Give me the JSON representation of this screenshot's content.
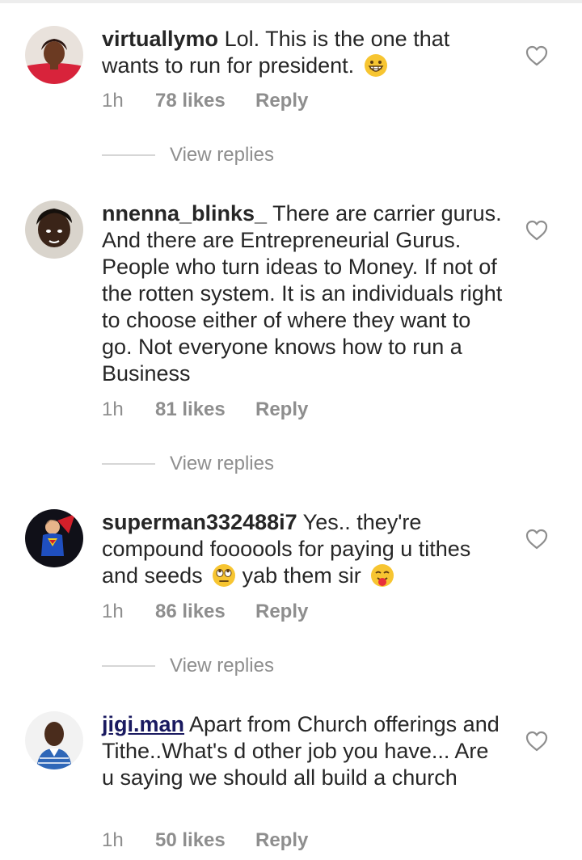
{
  "comments": [
    {
      "username": "virtuallymo",
      "text": "Lol. This is the one that wants to run for president.",
      "emojis": [
        "grinning-face"
      ],
      "time": "1h",
      "likes": "78 likes",
      "reply_label": "Reply",
      "view_replies": "View replies"
    },
    {
      "username": "nnenna_blinks_",
      "text": "There are carrier gurus. And there are Entrepreneurial Gurus. People who turn ideas to Money. If not of the rotten system. It is an individuals right to choose either of where they want to go. Not everyone knows how to run a Business",
      "time": "1h",
      "likes": "81 likes",
      "reply_label": "Reply",
      "view_replies": "View replies"
    },
    {
      "username": "superman332488i7",
      "text_part1": "Yes.. they're compound foooools for paying u tithes and seeds",
      "text_part2": "yab them sir",
      "emojis": [
        "rolling-eyes-face",
        "tongue-out-face"
      ],
      "time": "1h",
      "likes": "86 likes",
      "reply_label": "Reply",
      "view_replies": "View replies"
    },
    {
      "username": "jigi.man",
      "text": "Apart from Church offerings and Tithe..What's d other job you have... Are u saying we should all build a church",
      "time": "1h",
      "likes": "50 likes",
      "reply_label": "Reply"
    }
  ],
  "colors": {
    "text": "#262626",
    "meta": "#8e8e8e",
    "divider": "#d6d6d6",
    "mention_link": "#1a1a60"
  }
}
